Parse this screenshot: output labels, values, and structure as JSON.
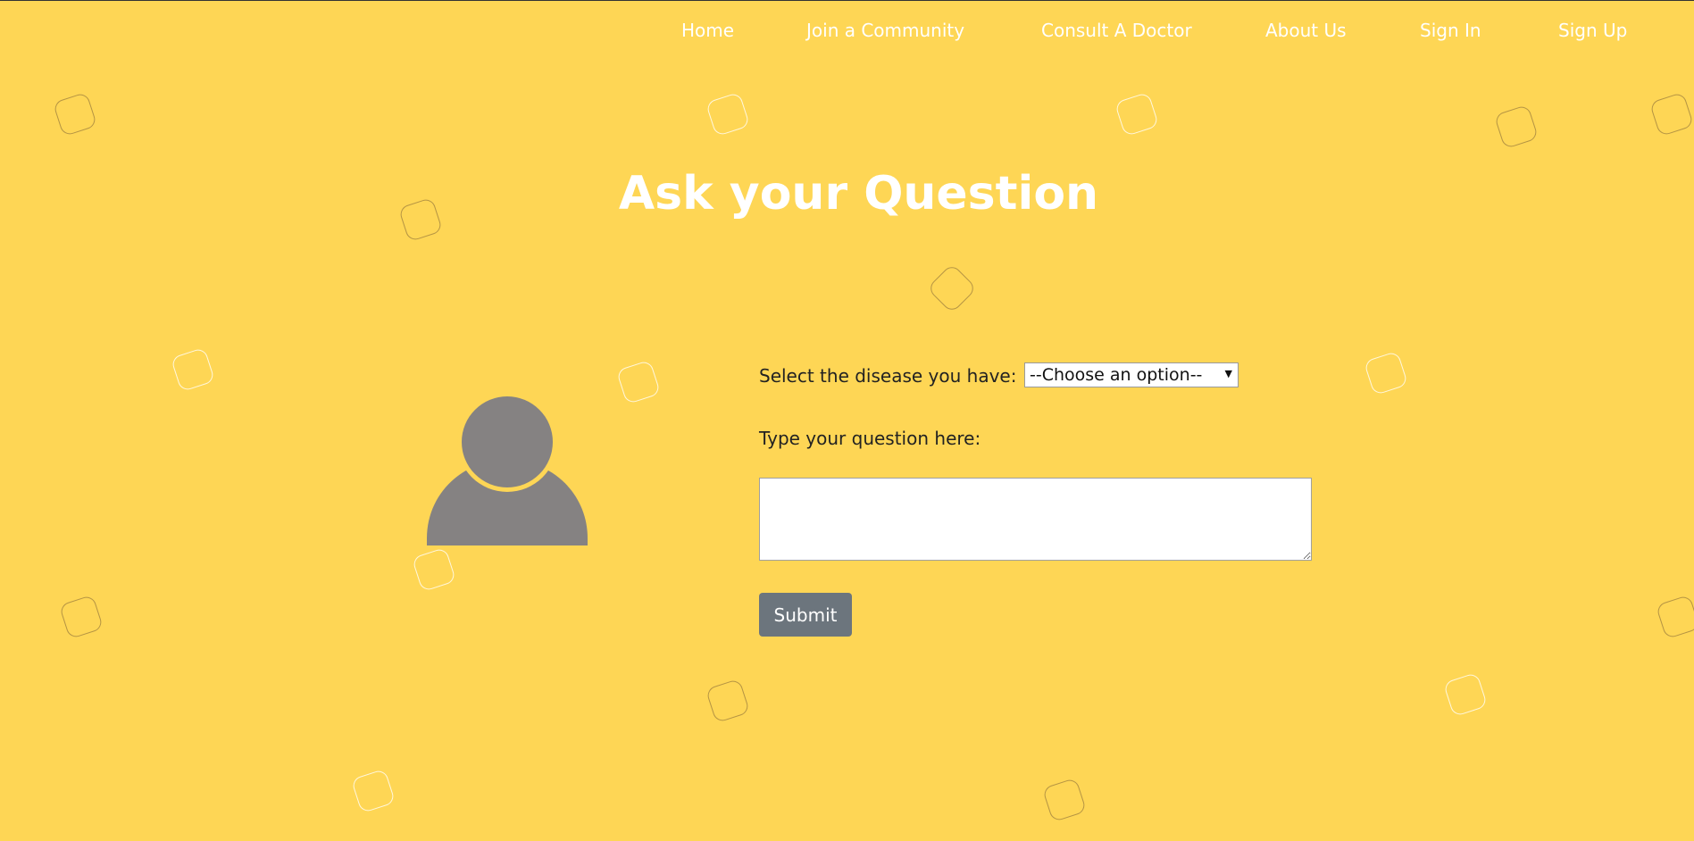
{
  "nav": {
    "items": [
      {
        "label": "Home"
      },
      {
        "label": "Join a Community"
      },
      {
        "label": "Consult A Doctor"
      },
      {
        "label": "About Us"
      },
      {
        "label": "Sign In"
      },
      {
        "label": "Sign Up"
      }
    ]
  },
  "page": {
    "title": "Ask your Question"
  },
  "form": {
    "disease_label": "Select the disease you have:",
    "disease_select": {
      "selected": "--Choose an option--"
    },
    "question_label": "Type your question here:",
    "question_value": "",
    "submit_label": "Submit"
  },
  "colors": {
    "background": "#FED655",
    "title": "#FFFFFF",
    "avatar": "#858282",
    "button": "#6C757D"
  },
  "icons": {
    "avatar": "user-silhouette-icon",
    "select_arrow": "caret-down-icon"
  }
}
